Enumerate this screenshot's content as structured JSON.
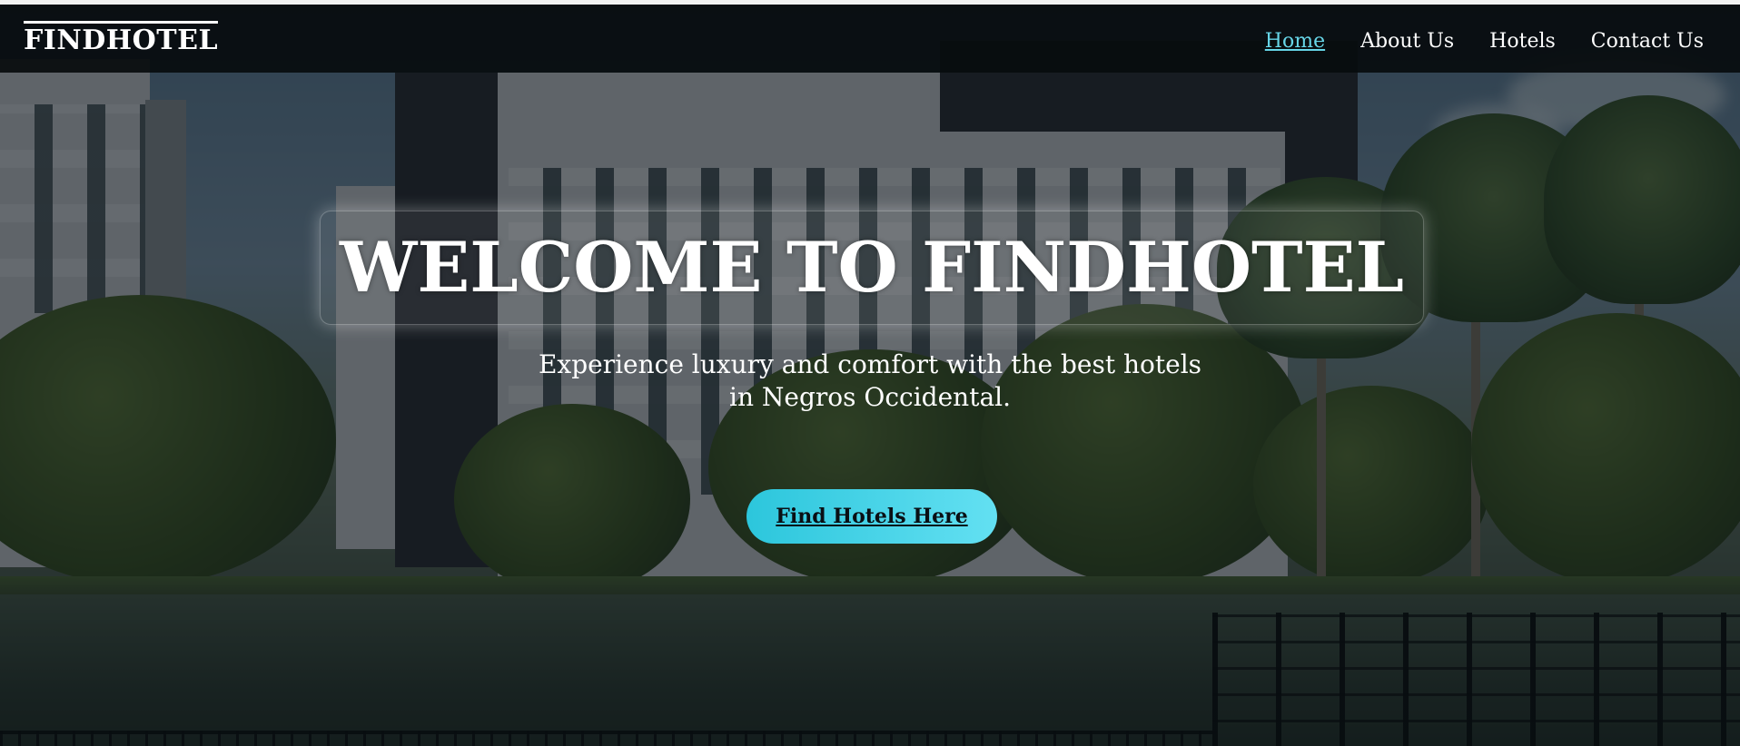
{
  "navbar": {
    "logo": "FINDHOTEL",
    "links": [
      {
        "label": "Home",
        "active": true
      },
      {
        "label": "About Us",
        "active": false
      },
      {
        "label": "Hotels",
        "active": false
      },
      {
        "label": "Contact Us",
        "active": false
      }
    ]
  },
  "hero": {
    "title": "WELCOME TO FINDHOTEL",
    "subtitle_line1": "Experience luxury and comfort with the best hotels",
    "subtitle_line2": "in Negros Occidental.",
    "cta_label": "Find Hotels Here"
  },
  "colors": {
    "accent": "#67d6e8",
    "button_start": "#2cc6dc",
    "button_end": "#63e0f2",
    "navbar_bg": "#080c0e"
  }
}
